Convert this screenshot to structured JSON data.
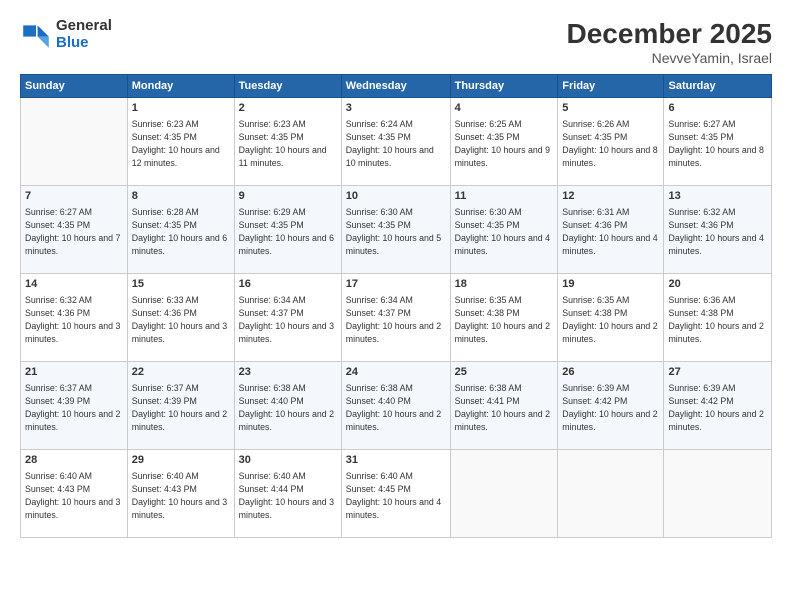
{
  "header": {
    "logo_general": "General",
    "logo_blue": "Blue",
    "month_title": "December 2025",
    "location": "NevveYamin, Israel"
  },
  "calendar": {
    "days_of_week": [
      "Sunday",
      "Monday",
      "Tuesday",
      "Wednesday",
      "Thursday",
      "Friday",
      "Saturday"
    ],
    "weeks": [
      [
        {
          "day": "",
          "sunrise": "",
          "sunset": "",
          "daylight": "",
          "empty": true
        },
        {
          "day": "1",
          "sunrise": "Sunrise: 6:23 AM",
          "sunset": "Sunset: 4:35 PM",
          "daylight": "Daylight: 10 hours and 12 minutes."
        },
        {
          "day": "2",
          "sunrise": "Sunrise: 6:23 AM",
          "sunset": "Sunset: 4:35 PM",
          "daylight": "Daylight: 10 hours and 11 minutes."
        },
        {
          "day": "3",
          "sunrise": "Sunrise: 6:24 AM",
          "sunset": "Sunset: 4:35 PM",
          "daylight": "Daylight: 10 hours and 10 minutes."
        },
        {
          "day": "4",
          "sunrise": "Sunrise: 6:25 AM",
          "sunset": "Sunset: 4:35 PM",
          "daylight": "Daylight: 10 hours and 9 minutes."
        },
        {
          "day": "5",
          "sunrise": "Sunrise: 6:26 AM",
          "sunset": "Sunset: 4:35 PM",
          "daylight": "Daylight: 10 hours and 8 minutes."
        },
        {
          "day": "6",
          "sunrise": "Sunrise: 6:27 AM",
          "sunset": "Sunset: 4:35 PM",
          "daylight": "Daylight: 10 hours and 8 minutes."
        }
      ],
      [
        {
          "day": "7",
          "sunrise": "Sunrise: 6:27 AM",
          "sunset": "Sunset: 4:35 PM",
          "daylight": "Daylight: 10 hours and 7 minutes."
        },
        {
          "day": "8",
          "sunrise": "Sunrise: 6:28 AM",
          "sunset": "Sunset: 4:35 PM",
          "daylight": "Daylight: 10 hours and 6 minutes."
        },
        {
          "day": "9",
          "sunrise": "Sunrise: 6:29 AM",
          "sunset": "Sunset: 4:35 PM",
          "daylight": "Daylight: 10 hours and 6 minutes."
        },
        {
          "day": "10",
          "sunrise": "Sunrise: 6:30 AM",
          "sunset": "Sunset: 4:35 PM",
          "daylight": "Daylight: 10 hours and 5 minutes."
        },
        {
          "day": "11",
          "sunrise": "Sunrise: 6:30 AM",
          "sunset": "Sunset: 4:35 PM",
          "daylight": "Daylight: 10 hours and 4 minutes."
        },
        {
          "day": "12",
          "sunrise": "Sunrise: 6:31 AM",
          "sunset": "Sunset: 4:36 PM",
          "daylight": "Daylight: 10 hours and 4 minutes."
        },
        {
          "day": "13",
          "sunrise": "Sunrise: 6:32 AM",
          "sunset": "Sunset: 4:36 PM",
          "daylight": "Daylight: 10 hours and 4 minutes."
        }
      ],
      [
        {
          "day": "14",
          "sunrise": "Sunrise: 6:32 AM",
          "sunset": "Sunset: 4:36 PM",
          "daylight": "Daylight: 10 hours and 3 minutes."
        },
        {
          "day": "15",
          "sunrise": "Sunrise: 6:33 AM",
          "sunset": "Sunset: 4:36 PM",
          "daylight": "Daylight: 10 hours and 3 minutes."
        },
        {
          "day": "16",
          "sunrise": "Sunrise: 6:34 AM",
          "sunset": "Sunset: 4:37 PM",
          "daylight": "Daylight: 10 hours and 3 minutes."
        },
        {
          "day": "17",
          "sunrise": "Sunrise: 6:34 AM",
          "sunset": "Sunset: 4:37 PM",
          "daylight": "Daylight: 10 hours and 2 minutes."
        },
        {
          "day": "18",
          "sunrise": "Sunrise: 6:35 AM",
          "sunset": "Sunset: 4:38 PM",
          "daylight": "Daylight: 10 hours and 2 minutes."
        },
        {
          "day": "19",
          "sunrise": "Sunrise: 6:35 AM",
          "sunset": "Sunset: 4:38 PM",
          "daylight": "Daylight: 10 hours and 2 minutes."
        },
        {
          "day": "20",
          "sunrise": "Sunrise: 6:36 AM",
          "sunset": "Sunset: 4:38 PM",
          "daylight": "Daylight: 10 hours and 2 minutes."
        }
      ],
      [
        {
          "day": "21",
          "sunrise": "Sunrise: 6:37 AM",
          "sunset": "Sunset: 4:39 PM",
          "daylight": "Daylight: 10 hours and 2 minutes."
        },
        {
          "day": "22",
          "sunrise": "Sunrise: 6:37 AM",
          "sunset": "Sunset: 4:39 PM",
          "daylight": "Daylight: 10 hours and 2 minutes."
        },
        {
          "day": "23",
          "sunrise": "Sunrise: 6:38 AM",
          "sunset": "Sunset: 4:40 PM",
          "daylight": "Daylight: 10 hours and 2 minutes."
        },
        {
          "day": "24",
          "sunrise": "Sunrise: 6:38 AM",
          "sunset": "Sunset: 4:40 PM",
          "daylight": "Daylight: 10 hours and 2 minutes."
        },
        {
          "day": "25",
          "sunrise": "Sunrise: 6:38 AM",
          "sunset": "Sunset: 4:41 PM",
          "daylight": "Daylight: 10 hours and 2 minutes."
        },
        {
          "day": "26",
          "sunrise": "Sunrise: 6:39 AM",
          "sunset": "Sunset: 4:42 PM",
          "daylight": "Daylight: 10 hours and 2 minutes."
        },
        {
          "day": "27",
          "sunrise": "Sunrise: 6:39 AM",
          "sunset": "Sunset: 4:42 PM",
          "daylight": "Daylight: 10 hours and 2 minutes."
        }
      ],
      [
        {
          "day": "28",
          "sunrise": "Sunrise: 6:40 AM",
          "sunset": "Sunset: 4:43 PM",
          "daylight": "Daylight: 10 hours and 3 minutes."
        },
        {
          "day": "29",
          "sunrise": "Sunrise: 6:40 AM",
          "sunset": "Sunset: 4:43 PM",
          "daylight": "Daylight: 10 hours and 3 minutes."
        },
        {
          "day": "30",
          "sunrise": "Sunrise: 6:40 AM",
          "sunset": "Sunset: 4:44 PM",
          "daylight": "Daylight: 10 hours and 3 minutes."
        },
        {
          "day": "31",
          "sunrise": "Sunrise: 6:40 AM",
          "sunset": "Sunset: 4:45 PM",
          "daylight": "Daylight: 10 hours and 4 minutes."
        },
        {
          "day": "",
          "sunrise": "",
          "sunset": "",
          "daylight": "",
          "empty": true
        },
        {
          "day": "",
          "sunrise": "",
          "sunset": "",
          "daylight": "",
          "empty": true
        },
        {
          "day": "",
          "sunrise": "",
          "sunset": "",
          "daylight": "",
          "empty": true
        }
      ]
    ]
  }
}
